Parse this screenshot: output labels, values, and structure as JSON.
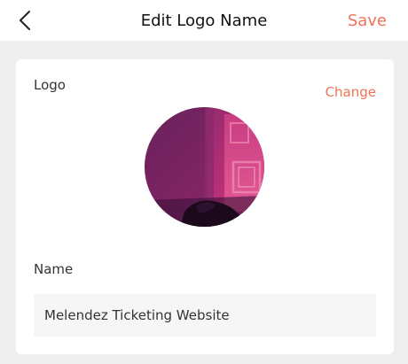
{
  "header": {
    "title": "Edit Logo Name",
    "save_label": "Save"
  },
  "card": {
    "logo_label": "Logo",
    "change_label": "Change",
    "name_label": "Name",
    "name_value": "Melendez Ticketing Website"
  },
  "colors": {
    "accent": "#ee7357",
    "background": "#efefef",
    "card": "#ffffff",
    "input": "#f6f6f6"
  },
  "icons": {
    "back": "chevron-left-icon"
  }
}
